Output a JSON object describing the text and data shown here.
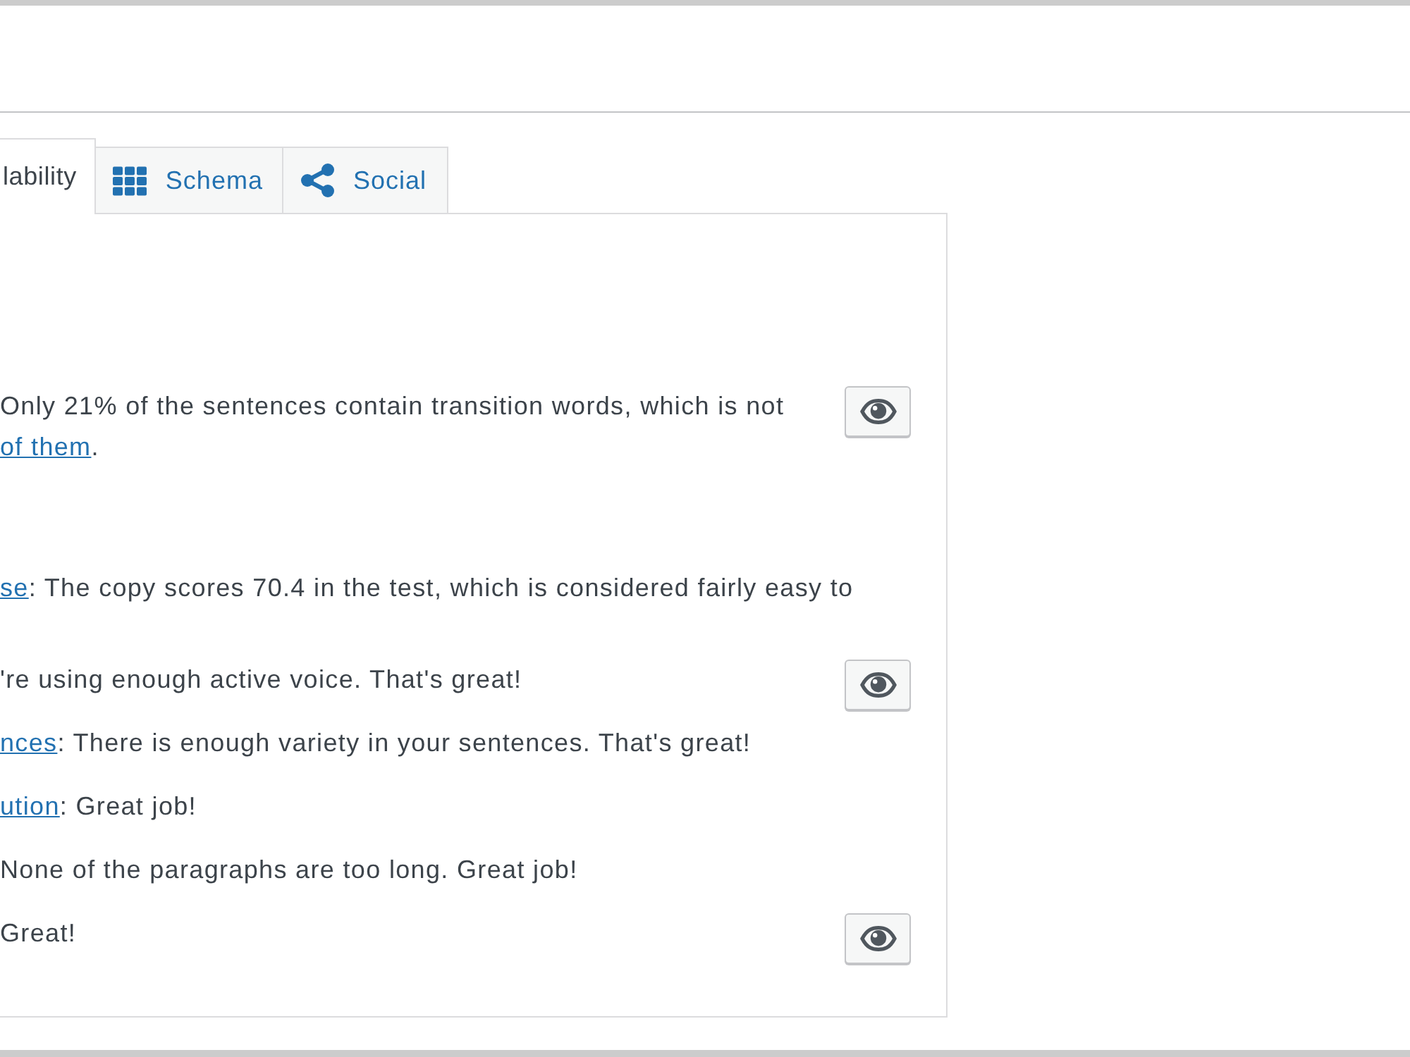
{
  "tabs": [
    {
      "kind": "readability",
      "label": "lability",
      "selected": true
    },
    {
      "kind": "schema",
      "label": "Schema",
      "selected": false
    },
    {
      "kind": "social",
      "label": "Social",
      "selected": false
    }
  ],
  "sections": [
    {
      "results": [
        {
          "lines": [
            {
              "text": "Only 21% of the sentences contain transition words, which is not"
            },
            {
              "link": "of them",
              "text": "."
            }
          ],
          "highlight_button": true
        }
      ]
    },
    {
      "results": [
        {
          "lines": [
            {
              "link": "se",
              "text": ": The copy scores 70.4 in the test, which is considered fairly easy to"
            }
          ],
          "highlight_button": false
        },
        {
          "lines": [
            {
              "text": "'re using enough active voice. That's great!"
            }
          ],
          "highlight_button": true
        },
        {
          "lines": [
            {
              "link": "nces",
              "text": ": There is enough variety in your sentences. That's great!"
            }
          ],
          "highlight_button": false
        },
        {
          "lines": [
            {
              "link": "ution",
              "text": ": Great job!"
            }
          ],
          "highlight_button": false
        },
        {
          "lines": [
            {
              "text": "None of the paragraphs are too long. Great job!"
            }
          ],
          "highlight_button": false
        },
        {
          "lines": [
            {
              "text": "Great!"
            }
          ],
          "highlight_button": true
        }
      ]
    }
  ]
}
